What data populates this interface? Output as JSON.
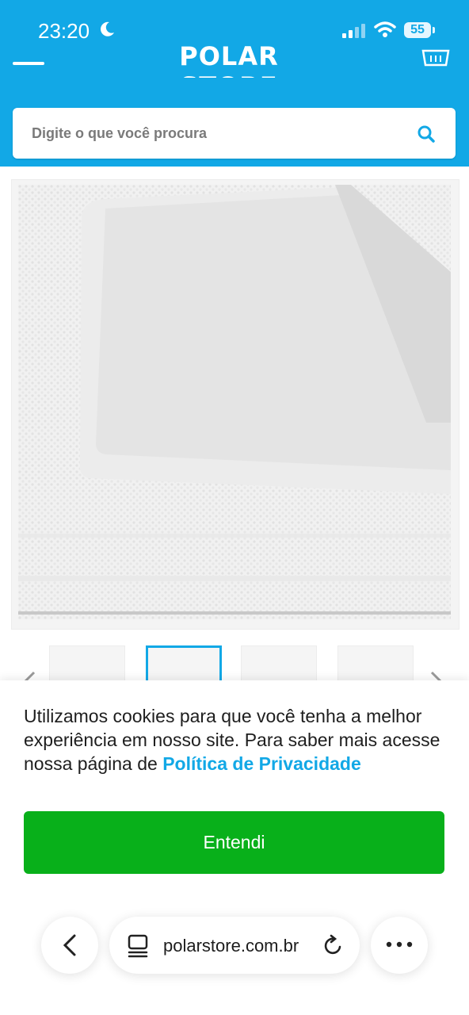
{
  "status_bar": {
    "time": "23:20",
    "battery": "55"
  },
  "header": {
    "logo_text": "POLAR STORE",
    "accent_color": "#12a8e6"
  },
  "search": {
    "placeholder": "Digite o que você procura"
  },
  "product": {
    "image_alt": "Placas de isopor",
    "thumbnails_count": 4,
    "active_thumbnail": 1
  },
  "cookie_banner": {
    "text": "Utilizamos cookies para que você tenha a melhor experiência em nosso site. Para saber mais acesse nossa página de ",
    "link_label": "Política de Privacidade",
    "button_label": "Entendi",
    "button_color": "#08b01a"
  },
  "browser": {
    "url": "polarstore.com.br"
  }
}
